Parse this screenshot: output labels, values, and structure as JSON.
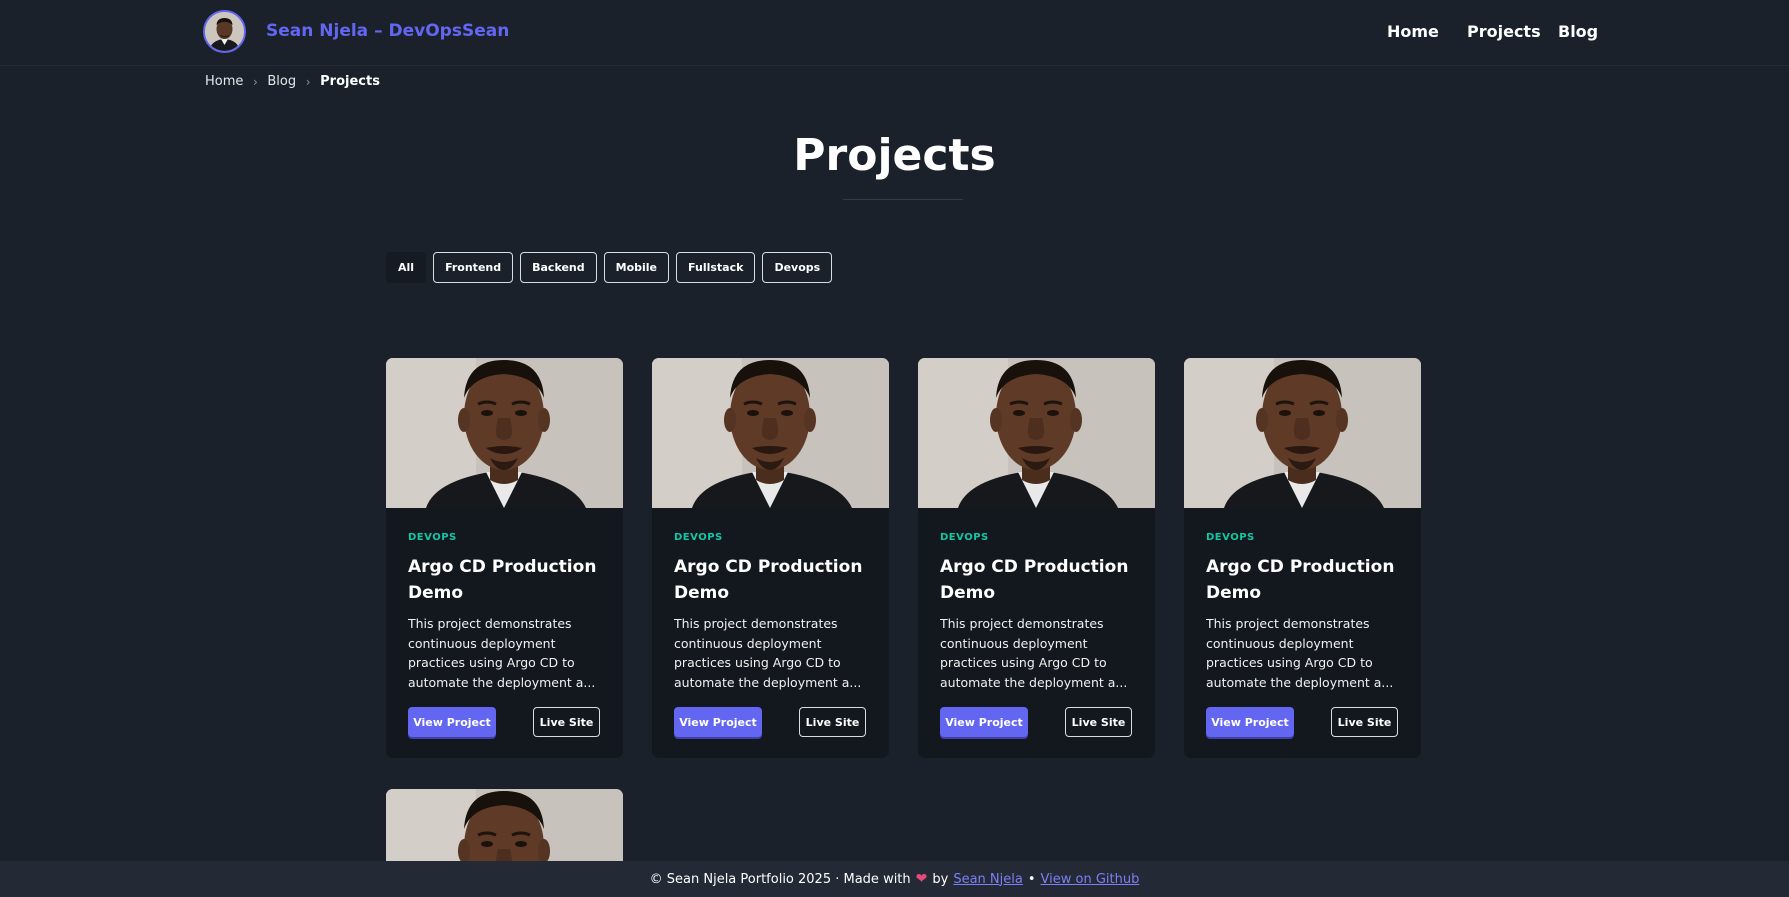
{
  "header": {
    "brand": "Sean Njela – DevOpsSean",
    "nav": {
      "home": "Home",
      "projects": "Projects",
      "blog": "Blog"
    }
  },
  "breadcrumb": {
    "home": "Home",
    "blog": "Blog",
    "current": "Projects",
    "separator": "›"
  },
  "page": {
    "title": "Projects"
  },
  "filters": [
    "All",
    "Frontend",
    "Backend",
    "Mobile",
    "Fullstack",
    "Devops"
  ],
  "active_filter": "All",
  "cards": [
    {
      "tag": "DEVOPS",
      "title": "Argo CD Production Demo",
      "description": "This project demonstrates continuous deployment practices using Argo CD to automate the deployment a...",
      "view_label": "View Project",
      "live_label": "Live Site"
    },
    {
      "tag": "DEVOPS",
      "title": "Argo CD Production Demo",
      "description": "This project demonstrates continuous deployment practices using Argo CD to automate the deployment a...",
      "view_label": "View Project",
      "live_label": "Live Site"
    },
    {
      "tag": "DEVOPS",
      "title": "Argo CD Production Demo",
      "description": "This project demonstrates continuous deployment practices using Argo CD to automate the deployment a...",
      "view_label": "View Project",
      "live_label": "Live Site"
    },
    {
      "tag": "DEVOPS",
      "title": "Argo CD Production Demo",
      "description": "This project demonstrates continuous deployment practices using Argo CD to automate the deployment a...",
      "view_label": "View Project",
      "live_label": "Live Site"
    }
  ],
  "footer": {
    "copyright": "© Sean Njela Portfolio 2025 · Made with",
    "by": "by",
    "author_link": "Sean Njela",
    "bullet": "•",
    "github_link": "View on Github"
  },
  "colors": {
    "background": "#1b212b",
    "accent": "#6366f1",
    "tag": "#14c7a3",
    "card": "#13171e",
    "footer": "#232a35"
  },
  "icons": [
    "avatar-photo",
    "chevron-right-icon",
    "heart-icon"
  ]
}
